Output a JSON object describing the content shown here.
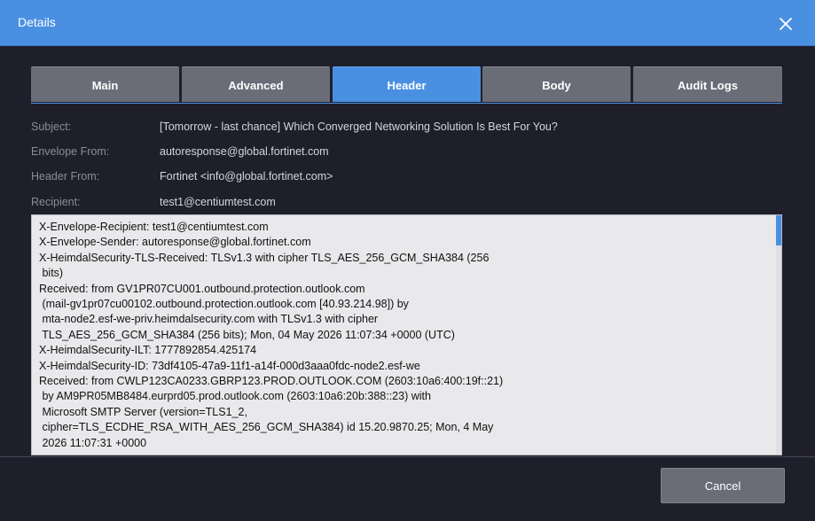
{
  "window": {
    "title": "Details",
    "close_icon": "close-icon"
  },
  "tabs": [
    {
      "label": "Main"
    },
    {
      "label": "Advanced"
    },
    {
      "label": "Header",
      "active": true
    },
    {
      "label": "Body"
    },
    {
      "label": "Audit Logs"
    }
  ],
  "fields": {
    "subject": {
      "label": "Subject:",
      "value": "[Tomorrow - last chance] Which Converged Networking Solution Is Best For You?"
    },
    "envelope_from": {
      "label": "Envelope From:",
      "value": "autoresponse@global.fortinet.com"
    },
    "header_from": {
      "label": "Header From:",
      "value": "Fortinet <info@global.fortinet.com>"
    },
    "recipient": {
      "label": "Recipient:",
      "value": "test1@centiumtest.com"
    }
  },
  "raw_headers": "X-Envelope-Recipient: test1@centiumtest.com\nX-Envelope-Sender: autoresponse@global.fortinet.com\nX-HeimdalSecurity-TLS-Received: TLSv1.3 with cipher TLS_AES_256_GCM_SHA384 (256\n bits)\nReceived: from GV1PR07CU001.outbound.protection.outlook.com\n (mail-gv1pr07cu00102.outbound.protection.outlook.com [40.93.214.98]) by\n mta-node2.esf-we-priv.heimdalsecurity.com with TLSv1.3 with cipher\n TLS_AES_256_GCM_SHA384 (256 bits); Mon, 04 May 2026 11:07:34 +0000 (UTC)\nX-HeimdalSecurity-ILT: 1777892854.425174\nX-HeimdalSecurity-ID: 73df4105-47a9-11f1-a14f-000d3aaa0fdc-node2.esf-we\nReceived: from CWLP123CA0233.GBRP123.PROD.OUTLOOK.COM (2603:10a6:400:19f::21)\n by AM9PR05MB8484.eurprd05.prod.outlook.com (2603:10a6:20b:388::23) with\n Microsoft SMTP Server (version=TLS1_2,\n cipher=TLS_ECDHE_RSA_WITH_AES_256_GCM_SHA384) id 15.20.9870.25; Mon, 4 May\n 2026 11:07:31 +0000",
  "footer": {
    "cancel_label": "Cancel"
  },
  "colors": {
    "accent": "#4a90e2",
    "background": "#1f1f2b",
    "tab_inactive": "#6a6d78"
  }
}
